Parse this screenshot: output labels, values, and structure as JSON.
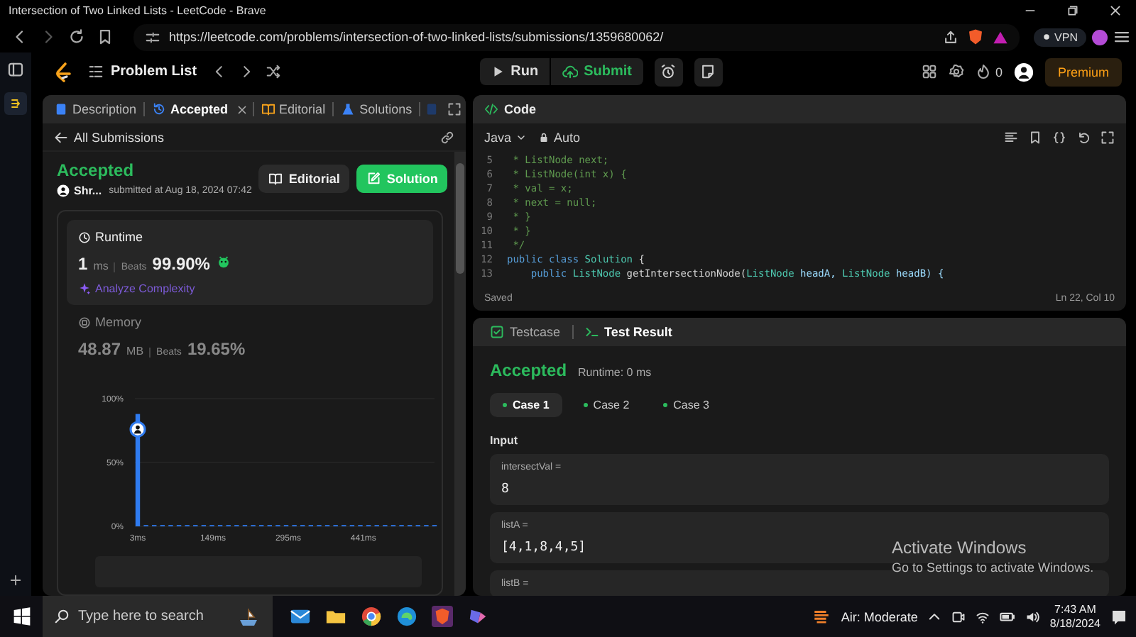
{
  "browser": {
    "title": "Intersection of Two Linked Lists - LeetCode - Brave",
    "url": "https://leetcode.com/problems/intersection-of-two-linked-lists/submissions/1359680062/",
    "vpn": "VPN"
  },
  "topbar": {
    "problem_list": "Problem List",
    "run": "Run",
    "submit": "Submit",
    "points": "0",
    "premium": "Premium"
  },
  "left_panel": {
    "tabs": [
      {
        "label": "Description",
        "selected": false,
        "closable": false
      },
      {
        "label": "Accepted",
        "selected": true,
        "closable": true
      },
      {
        "label": "Editorial",
        "selected": false,
        "closable": false
      },
      {
        "label": "Solutions",
        "selected": false,
        "closable": false
      }
    ],
    "back": "All Submissions",
    "status": "Accepted",
    "user": "Shr...",
    "submitted": "submitted at Aug 18, 2024 07:42",
    "buttons": [
      {
        "label": "Editorial",
        "kind": "secondary"
      },
      {
        "label": "Solution",
        "kind": "primary"
      }
    ],
    "metrics": [
      {
        "kind": "runtime",
        "title": "Runtime",
        "selected": true,
        "value": "1",
        "unit": "ms",
        "beats_label": "Beats",
        "beats": "99.90%",
        "analyze": "Analyze Complexity"
      },
      {
        "kind": "memory",
        "title": "Memory",
        "selected": false,
        "value": "48.87",
        "unit": "MB",
        "beats_label": "Beats",
        "beats": "19.65%"
      }
    ],
    "chart_data": {
      "type": "bar",
      "x": [
        3,
        19,
        35,
        51,
        67,
        83,
        99,
        115,
        131,
        147,
        163,
        179,
        195,
        211,
        227,
        243,
        259,
        275,
        291,
        307,
        323,
        339,
        355,
        371,
        387,
        403,
        419,
        435,
        451,
        467,
        483,
        499,
        515,
        531,
        547,
        563,
        579
      ],
      "series": [
        {
          "color": "#2f7bf0",
          "values": [
            88,
            1,
            1,
            1,
            1,
            1,
            1,
            1,
            1,
            1,
            1,
            1,
            1,
            1,
            1,
            1,
            1,
            1,
            1,
            1,
            1,
            1,
            1,
            1,
            1,
            1,
            1,
            1,
            1,
            1,
            1,
            1,
            1,
            1,
            1,
            1,
            1
          ]
        }
      ],
      "xlim": [
        3,
        579
      ],
      "ylim": [
        0,
        100
      ],
      "xticks": [
        {
          "value": 3,
          "label": "3ms"
        },
        {
          "value": 149,
          "label": "149ms"
        },
        {
          "value": 295,
          "label": "295ms"
        },
        {
          "value": 441,
          "label": "441ms"
        }
      ],
      "yticks": [
        {
          "value": 0,
          "label": "0%"
        },
        {
          "value": 50,
          "label": "50%"
        },
        {
          "value": 100,
          "label": "100%"
        }
      ]
    }
  },
  "editor": {
    "title": "Code",
    "language": "Java",
    "mode": "Auto",
    "lines": [
      {
        "number": "5",
        "tokens": [
          {
            "text": " * ListNode next;",
            "kind": "comment"
          }
        ]
      },
      {
        "number": "6",
        "tokens": [
          {
            "text": " * ListNode(int x) {",
            "kind": "comment"
          }
        ]
      },
      {
        "number": "7",
        "tokens": [
          {
            "text": " * val = x;",
            "kind": "comment"
          }
        ]
      },
      {
        "number": "8",
        "tokens": [
          {
            "text": " * next = null;",
            "kind": "comment"
          }
        ]
      },
      {
        "number": "9",
        "tokens": [
          {
            "text": " * }",
            "kind": "comment"
          }
        ]
      },
      {
        "number": "10",
        "tokens": [
          {
            "text": " * }",
            "kind": "comment"
          }
        ]
      },
      {
        "number": "11",
        "tokens": [
          {
            "text": " */",
            "kind": "comment"
          }
        ]
      },
      {
        "number": "12",
        "tokens": [
          {
            "text": "public class ",
            "kind": "keyword"
          },
          {
            "text": "Solution",
            "kind": "type"
          },
          {
            "text": " {",
            "kind": "plain"
          }
        ]
      },
      {
        "number": "13",
        "tokens": [
          {
            "text": "    public ",
            "kind": "keyword"
          },
          {
            "text": "ListNode",
            "kind": "type"
          },
          {
            "text": " getIntersectionNode(",
            "kind": "plain"
          },
          {
            "text": "ListNode",
            "kind": "type"
          },
          {
            "text": " headA, ",
            "kind": "ident"
          },
          {
            "text": "ListNode",
            "kind": "type"
          },
          {
            "text": " headB) {",
            "kind": "ident"
          }
        ]
      }
    ],
    "status": "Saved",
    "cursor": "Ln 22, Col 10"
  },
  "test": {
    "tabs": [
      {
        "label": "Testcase",
        "selected": false
      },
      {
        "label": "Test Result",
        "selected": true
      }
    ],
    "verdict": "Accepted",
    "runtime": "Runtime: 0 ms",
    "cases": [
      {
        "label": "Case 1",
        "selected": true,
        "passed": true
      },
      {
        "label": "Case 2",
        "selected": false,
        "passed": true
      },
      {
        "label": "Case 3",
        "selected": false,
        "passed": true
      }
    ],
    "input_label": "Input",
    "inputs": [
      {
        "name": "intersectVal =",
        "value": "8"
      },
      {
        "name": "listA =",
        "value": "[4,1,8,4,5]"
      },
      {
        "name": "listB ="
      }
    ]
  },
  "activation": {
    "title": "Activate Windows",
    "subtitle": "Go to Settings to activate Windows."
  },
  "taskbar": {
    "search_placeholder": "Type here to search",
    "weather": "Air: Moderate",
    "time": "7:43 AM",
    "date": "8/18/2024"
  }
}
